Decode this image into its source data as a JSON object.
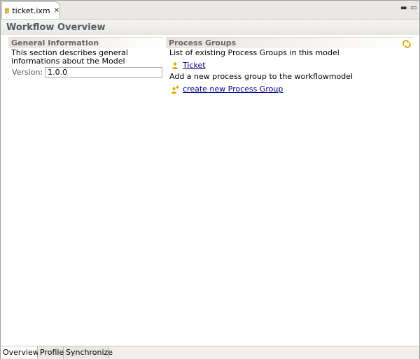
{
  "editor_tab": {
    "file_name": "ticket.ixm",
    "close_glyph": "✕",
    "icon": "file-icon"
  },
  "window_controls": {
    "minimize_glyph": "▬",
    "maximize_glyph": "▭"
  },
  "form": {
    "title": "Workflow Overview"
  },
  "general_information": {
    "title": "General Information",
    "description": "This section describes general informations about the Model",
    "version_label": "Version:",
    "version_value": "1.0.0"
  },
  "process_groups": {
    "title": "Process Groups",
    "description": "List of existing Process Groups in this model",
    "items": [
      {
        "label": "Ticket",
        "icon": "process-group-icon"
      }
    ],
    "add_description": "Add a new process group to the workflowmodel",
    "create_link": "create new Process Group",
    "refresh_icon": "refresh-icon"
  },
  "page_tabs": [
    {
      "label": "Overview",
      "active": true
    },
    {
      "label": "Profile",
      "active": false
    },
    {
      "label": "Synchronize",
      "active": false
    }
  ],
  "colors": {
    "title_text": "#505c6b",
    "link": "#00007f",
    "section_title": "#676767"
  }
}
